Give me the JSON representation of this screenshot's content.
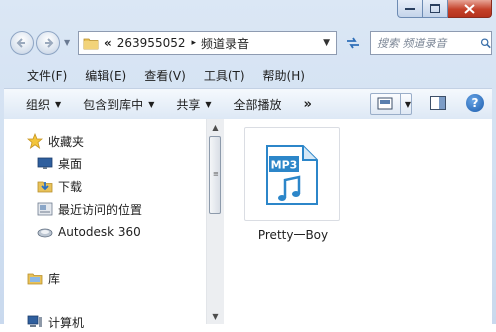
{
  "address": {
    "chevron": "«",
    "segments": [
      "263955052",
      "频道录音"
    ],
    "separator": "▸"
  },
  "search": {
    "placeholder": "搜索 频道录音"
  },
  "menu": [
    "文件(F)",
    "编辑(E)",
    "查看(V)",
    "工具(T)",
    "帮助(H)"
  ],
  "toolbar": {
    "organize": "组织",
    "include_library": "包含到库中",
    "share": "共享",
    "play_all": "全部播放",
    "more": "»"
  },
  "nav": {
    "favorites": "收藏夹",
    "desktop": "桌面",
    "downloads": "下载",
    "recent": "最近访问的位置",
    "autodesk": "Autodesk 360",
    "libraries": "库",
    "computer": "计算机"
  },
  "file": {
    "type_badge": "MP3",
    "name": "Pretty一Boy",
    "icon": "music-note-icon"
  },
  "help_label": "?",
  "colors": {
    "accent": "#2f6fb8",
    "close_red": "#c4412a",
    "file_blue": "#2c86c9"
  }
}
